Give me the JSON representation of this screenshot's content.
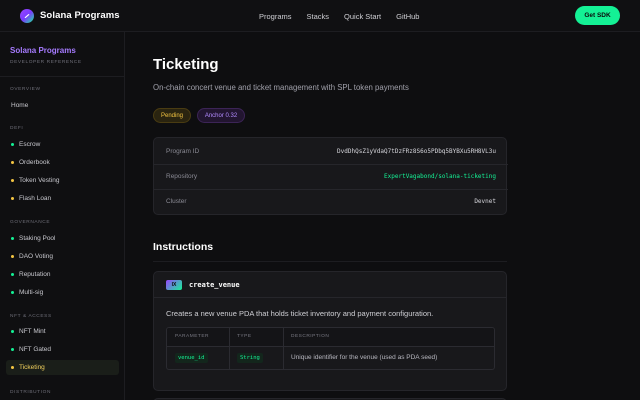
{
  "header": {
    "brand": "Solana Programs",
    "nav": [
      "Programs",
      "Stacks",
      "Quick Start",
      "GitHub"
    ],
    "cta_label": "Get SDK"
  },
  "sidebar": {
    "title": "Solana Programs",
    "subtitle": "DEVELOPER REFERENCE",
    "sections": [
      {
        "label": "OVERVIEW",
        "items": [
          {
            "label": "Home"
          }
        ]
      },
      {
        "label": "DEFI",
        "items": [
          {
            "label": "Escrow",
            "dot": "#14f195"
          },
          {
            "label": "Orderbook",
            "dot": "#f4c542"
          },
          {
            "label": "Token Vesting",
            "dot": "#f4c542"
          },
          {
            "label": "Flash Loan",
            "dot": "#f4c542"
          }
        ]
      },
      {
        "label": "GOVERNANCE",
        "items": [
          {
            "label": "Staking Pool",
            "dot": "#14f195"
          },
          {
            "label": "DAO Voting",
            "dot": "#f4c542"
          },
          {
            "label": "Reputation",
            "dot": "#14f195"
          },
          {
            "label": "Multi-sig",
            "dot": "#14f195"
          }
        ]
      },
      {
        "label": "NFT & ACCESS",
        "items": [
          {
            "label": "NFT Mint",
            "dot": "#14f195"
          },
          {
            "label": "NFT Gated",
            "dot": "#14f195"
          },
          {
            "label": "Ticketing",
            "dot": "#f4c542",
            "active": true
          }
        ]
      },
      {
        "label": "DISTRIBUTION",
        "items": []
      }
    ]
  },
  "page": {
    "title": "Ticketing",
    "subtitle": "On-chain concert venue and ticket management with SPL token payments",
    "badges": {
      "status": "Pending",
      "framework": "Anchor 0.32"
    },
    "info": [
      {
        "key": "Program ID",
        "value": "DvdDhQsZ1yVdaQ7tDzFRz8S6o5PDbq5BYBXu5RH8VL3u"
      },
      {
        "key": "Repository",
        "value": "ExpertVagabond/solana-ticketing"
      },
      {
        "key": "Cluster",
        "value": "Devnet"
      }
    ],
    "instructions_heading": "Instructions",
    "instruction": {
      "tag": "IX",
      "name": "create_venue",
      "description": "Creates a new venue PDA that holds ticket inventory and payment configuration.",
      "columns": [
        "PARAMETER",
        "TYPE",
        "DESCRIPTION"
      ],
      "rows": [
        {
          "param": "venue_id",
          "type": "String",
          "desc": "Unique identifier for the venue (used as PDA seed)"
        }
      ]
    }
  },
  "colors": {
    "accent_green": "#14f195",
    "accent_purple": "#9945ff",
    "pending": "#f4c542"
  }
}
